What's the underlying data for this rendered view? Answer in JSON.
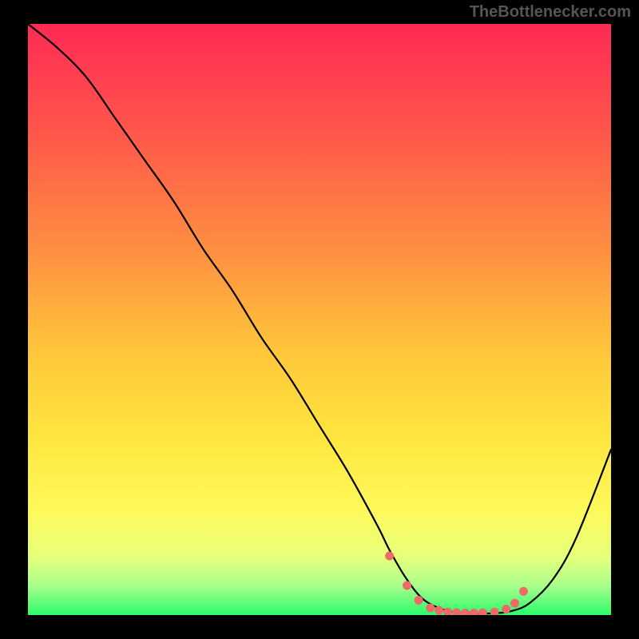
{
  "watermark": "TheBottlenecker.com",
  "chart_data": {
    "type": "line",
    "title": "",
    "xlabel": "",
    "ylabel": "",
    "xlim": [
      0,
      100
    ],
    "ylim": [
      0,
      100
    ],
    "grid": false,
    "legend": false,
    "series": [
      {
        "name": "curve",
        "x": [
          0,
          5,
          10,
          15,
          20,
          25,
          30,
          35,
          40,
          45,
          50,
          55,
          60,
          62,
          65,
          68,
          72,
          76,
          80,
          83,
          86,
          90,
          94,
          100
        ],
        "y": [
          100,
          96,
          91,
          84,
          77,
          70,
          62,
          55,
          47,
          40,
          32,
          24,
          15,
          11,
          6,
          2.5,
          0.7,
          0.3,
          0.3,
          0.7,
          2,
          6,
          13,
          28
        ]
      }
    ],
    "markers": {
      "name": "highlight-dots",
      "color": "#ee6a66",
      "x": [
        62,
        65,
        67,
        69,
        70.5,
        72,
        73.5,
        75,
        76.5,
        78,
        80,
        82,
        83.5,
        85
      ],
      "y": [
        10,
        5,
        2.5,
        1.2,
        0.8,
        0.5,
        0.4,
        0.35,
        0.35,
        0.4,
        0.5,
        1.0,
        2.0,
        4.0
      ]
    },
    "background_gradient": {
      "stops": [
        {
          "offset": 0.0,
          "color": "#ff2a55"
        },
        {
          "offset": 0.2,
          "color": "#ff5b4a"
        },
        {
          "offset": 0.4,
          "color": "#ff9440"
        },
        {
          "offset": 0.55,
          "color": "#ffc53a"
        },
        {
          "offset": 0.7,
          "color": "#ffe63f"
        },
        {
          "offset": 0.82,
          "color": "#fff95a"
        },
        {
          "offset": 0.9,
          "color": "#e8ff7a"
        },
        {
          "offset": 0.95,
          "color": "#aaff8c"
        },
        {
          "offset": 1.0,
          "color": "#2bfc6c"
        }
      ]
    }
  }
}
